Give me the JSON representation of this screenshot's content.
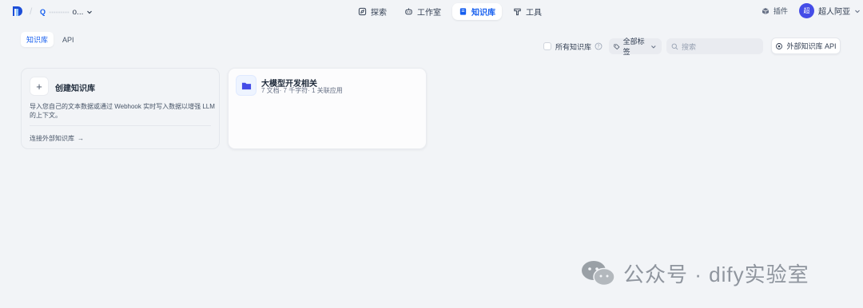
{
  "header": {
    "workspace_letter": "Q",
    "workspace_name_blurred": "·········",
    "workspace_name_tail": "o...",
    "nav": [
      {
        "label": "探索",
        "icon": "compass-icon",
        "active": false
      },
      {
        "label": "工作室",
        "icon": "robot-icon",
        "active": false
      },
      {
        "label": "知识库",
        "icon": "book-icon",
        "active": true
      },
      {
        "label": "工具",
        "icon": "hammer-icon",
        "active": false
      }
    ],
    "plugin_label": "插件",
    "user_avatar_text": "超",
    "user_name": "超人阿亚"
  },
  "tabs": [
    {
      "label": "知识库",
      "active": true
    },
    {
      "label": "API",
      "active": false
    }
  ],
  "filters": {
    "all_kb_label": "所有知识库",
    "tag_filter_label": "全部标签",
    "search_placeholder": "搜索",
    "external_api_label": "外部知识库 API"
  },
  "create_card": {
    "plus": "+",
    "title": "创建知识库",
    "description": "导入您自己的文本数据或通过 Webhook 实时写入数据以增强 LLM 的上下文。",
    "connect_label": "连接外部知识库",
    "arrow": "→"
  },
  "datasets": [
    {
      "title": "大模型开发相关",
      "meta": "7 文档· 7 千字符· 1 关联应用"
    }
  ],
  "watermark": {
    "text": "公众号 · dify实验室"
  },
  "colors": {
    "accent": "#155eef",
    "avatar": "#444ce7",
    "folder": "#444ce7",
    "background": "#f2f4f7"
  }
}
